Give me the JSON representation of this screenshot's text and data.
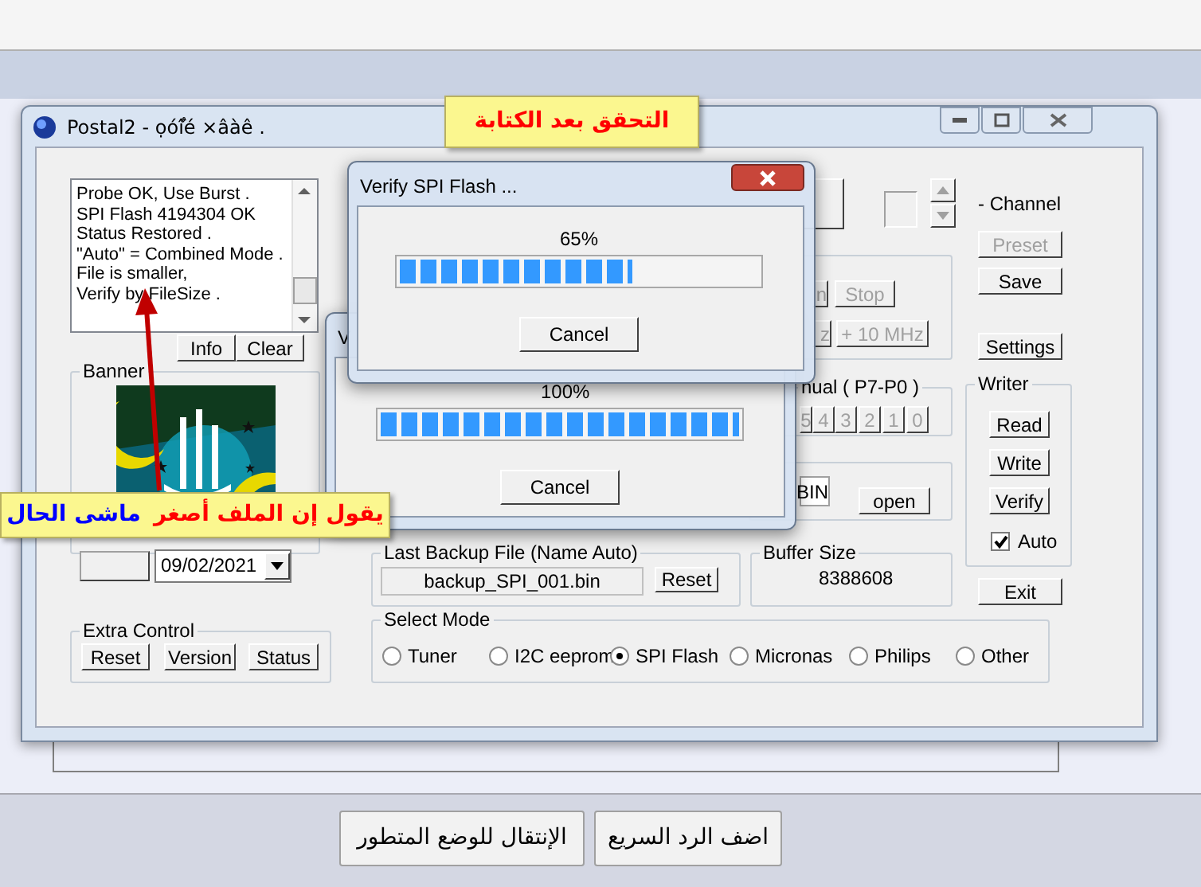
{
  "page": {
    "bottom_buttons": [
      "اضف الرد السريع",
      "الإنتقال للوضع المتطور"
    ]
  },
  "main_window": {
    "title": "Postal2 - ọóٌîé ×âàê .",
    "log_lines": [
      "Probe OK, Use Burst .",
      "SPI Flash 4194304 OK",
      "Status Restored .",
      "\"Auto\" = Combined Mode .",
      "File is smaller,",
      "Verify by FileSize ."
    ],
    "log_buttons": [
      "Info",
      "Clear"
    ],
    "banner": {
      "label": "Banner"
    },
    "date": "09/02/2021",
    "extra_control": {
      "label": "Extra Control",
      "buttons": [
        "Reset",
        "Version",
        "Status"
      ]
    },
    "last_backup": {
      "label": "Last Backup File (Name Auto)",
      "file": "backup_SPI_001.bin",
      "button": "Reset"
    },
    "buffer_size": {
      "label": "Buffer Size",
      "value": "8388608"
    },
    "select_mode": {
      "label": "Select Mode",
      "options": [
        {
          "label": "Tuner",
          "selected": false
        },
        {
          "label": "I2C eeprom",
          "selected": false
        },
        {
          "label": "SPI Flash",
          "selected": true
        },
        {
          "label": "Micronas",
          "selected": false
        },
        {
          "label": "Philips",
          "selected": false
        },
        {
          "label": "Other",
          "selected": false
        }
      ]
    },
    "channel_label": "- Channel",
    "side_buttons": [
      {
        "label": "Preset",
        "disabled": true
      },
      {
        "label": "Save",
        "disabled": false
      },
      {
        "label": "Settings",
        "disabled": false
      }
    ],
    "writer": {
      "label": "Writer",
      "buttons": [
        "Read",
        "Write",
        "Verify"
      ],
      "auto": {
        "label": "Auto",
        "checked": true
      }
    },
    "exit_button": "Exit",
    "tuning_buttons": [
      {
        "label": "n",
        "disabled": true
      },
      {
        "label": "Stop",
        "disabled": true
      },
      {
        "label": "z",
        "disabled": true
      },
      {
        "label": "+ 10 MHz",
        "disabled": true
      }
    ],
    "manual_group": {
      "label": "nual ( P7-P0 )",
      "bits": [
        {
          "label": "5",
          "disabled": true
        },
        {
          "label": "4",
          "disabled": true
        },
        {
          "label": "3",
          "disabled": true
        },
        {
          "label": "2",
          "disabled": true
        },
        {
          "label": "1",
          "disabled": true
        },
        {
          "label": "0",
          "disabled": true
        }
      ]
    },
    "file_group": {
      "field": "BIN",
      "button": "open"
    }
  },
  "back_dialog": {
    "title": "V",
    "percent": "100%",
    "level": 1,
    "button": "Cancel"
  },
  "verify_dialog": {
    "title": "Verify SPI Flash ...",
    "percent": "65%",
    "level": 0.65,
    "button": "Cancel"
  },
  "annotations": [
    {
      "segments": [
        {
          "text": "التحقق بعد الكتابة",
          "color": "#ff0000"
        }
      ]
    },
    {
      "segments": [
        {
          "text": "يقول إن الملف أصغر",
          "color": "#ff0000"
        },
        {
          "text": "ماشى الحال",
          "color": "#0000ff"
        }
      ]
    }
  ]
}
